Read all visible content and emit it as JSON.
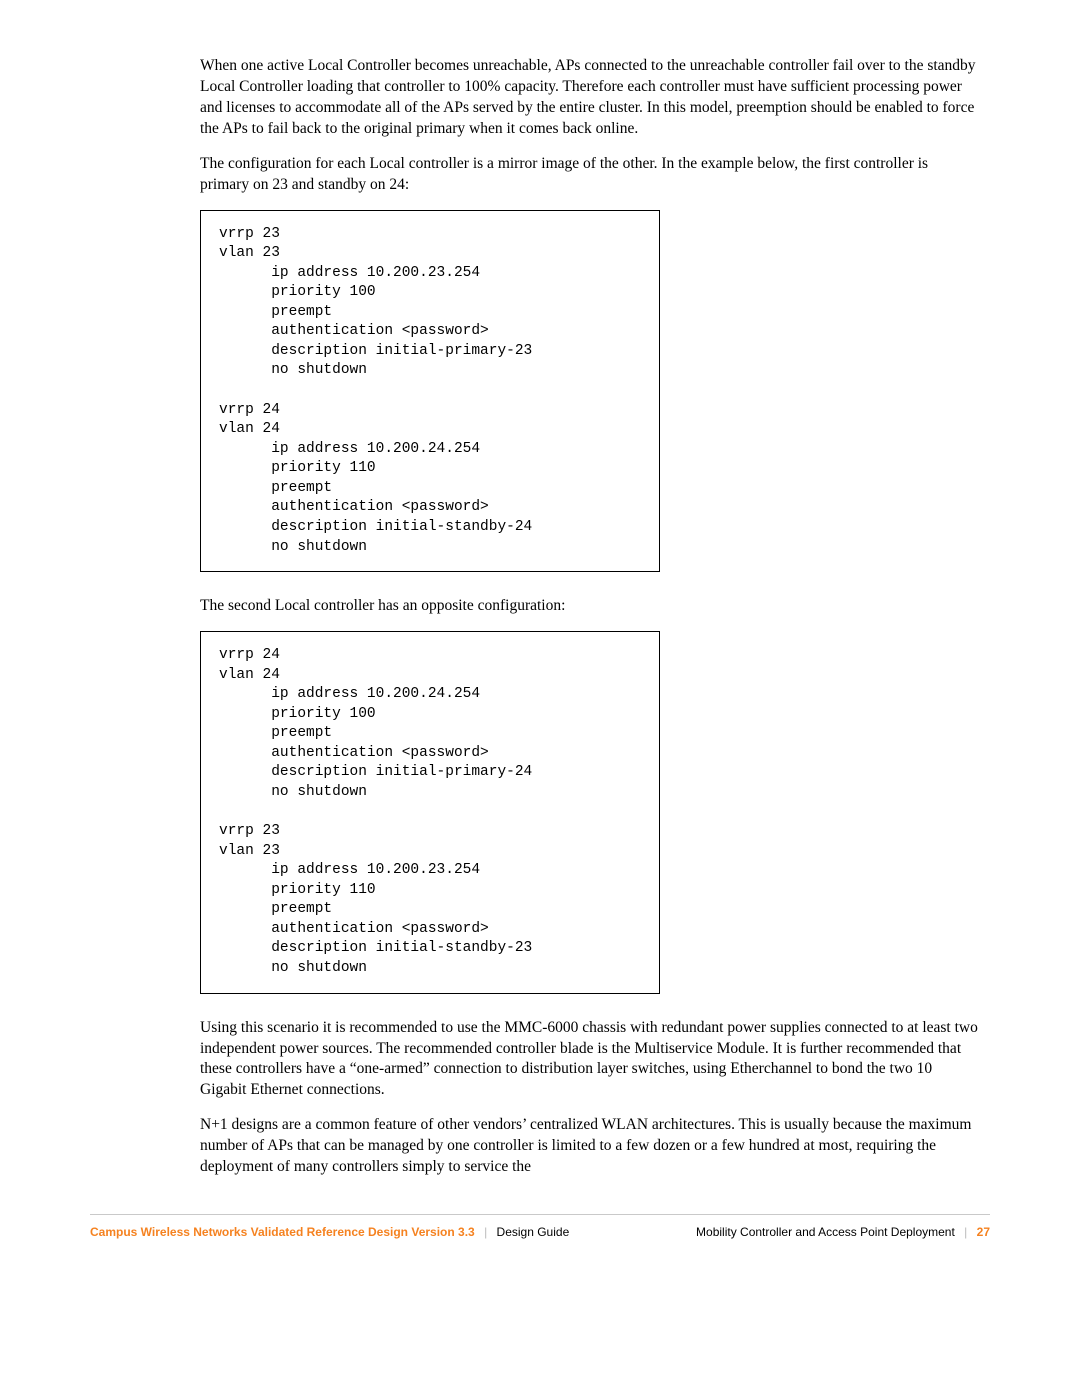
{
  "paragraphs": {
    "p1": "When one active Local Controller becomes unreachable, APs connected to the unreachable controller fail over to the standby Local Controller loading that controller to 100% capacity. Therefore each controller must have sufficient processing power and licenses to accommodate all of the APs served by the entire cluster. In this model, preemption should be enabled to force the APs to fail back to the original primary when it comes back online.",
    "p2": "The configuration for each Local controller is a mirror image of the other. In the example below, the first controller is primary on 23 and standby on 24:",
    "p3": "The second Local controller has an opposite configuration:",
    "p4": "Using this scenario it is recommended to use the MMC-6000 chassis with redundant power supplies connected to at least two independent power sources. The recommended controller blade is the Multiservice Module. It is further recommended that these controllers have a “one-armed” connection to distribution layer switches, using Etherchannel to bond the two 10 Gigabit Ethernet connections.",
    "p5": "N+1 designs are a common feature of other vendors’ centralized WLAN architectures. This is usually because the maximum number of APs that can be managed by one controller is limited to a few dozen or a few hundred at most, requiring the deployment of many controllers simply to service the"
  },
  "code1": "vrrp 23\nvlan 23\n      ip address 10.200.23.254\n      priority 100\n      preempt\n      authentication <password>\n      description initial-primary-23\n      no shutdown\n\nvrrp 24\nvlan 24\n      ip address 10.200.24.254\n      priority 110\n      preempt\n      authentication <password>\n      description initial-standby-24\n      no shutdown",
  "code2": "vrrp 24\nvlan 24\n      ip address 10.200.24.254\n      priority 100\n      preempt\n      authentication <password>\n      description initial-primary-24\n      no shutdown\n\nvrrp 23\nvlan 23\n      ip address 10.200.23.254\n      priority 110\n      preempt\n      authentication <password>\n      description initial-standby-23\n      no shutdown",
  "footer": {
    "brand": "Campus Wireless Networks Validated Reference Design Version 3.3",
    "left_sub": "Design Guide",
    "right_section": "Mobility Controller and Access Point Deployment",
    "page": "27",
    "sep": "|"
  }
}
